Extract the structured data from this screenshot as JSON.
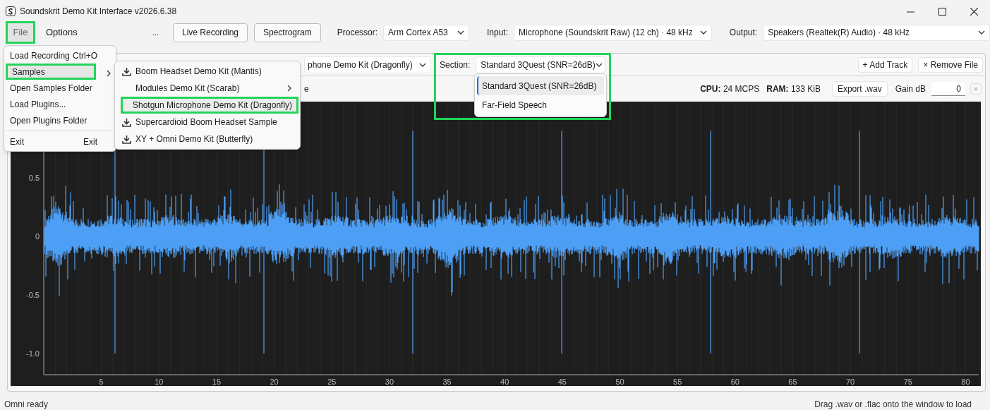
{
  "window": {
    "title": "Soundskrit Demo Kit Interface v2026.6.38"
  },
  "menu_bar": [
    {
      "label": "File",
      "selected": true,
      "highlighted": true
    },
    {
      "label": "Options",
      "selected": false,
      "highlighted": false
    }
  ],
  "toolbar": {
    "overflow": "...",
    "buttons": [
      "Live Recording",
      "Spectrogram"
    ],
    "selectors": [
      {
        "label": "Processor:",
        "value": "Arm Cortex A53"
      },
      {
        "label": "Input:",
        "value": "Microphone (Soundskrit Raw)  (12 ch) · 48 kHz"
      },
      {
        "label": "Output:",
        "value": "Speakers (Realtek(R) Audio) · 48 kHz"
      }
    ]
  },
  "file_row": {
    "file_select": "phone Demo Kit (Dragonfly)",
    "section": {
      "label": "Section:",
      "value": "Standard 3Quest (SNR=26dB)",
      "highlighted": true
    },
    "buttons": [
      "+ Add Track",
      "× Remove File"
    ]
  },
  "info_row": {
    "partial_text": "e",
    "cpu_label": "CPU:",
    "cpu": "24 MCPS",
    "ram_label": "RAM:",
    "ram": "133 KiB",
    "export": "Export .wav",
    "gain_label": "Gain dB",
    "gain": "0",
    "close": "×"
  },
  "waveform": {
    "y_ticks": [
      "0.5",
      "0",
      "-0.5",
      "-1.0"
    ],
    "x_ticks": [
      "5",
      "10",
      "15",
      "20",
      "25",
      "30",
      "35",
      "40",
      "45",
      "50",
      "55",
      "60",
      "65",
      "70",
      "75",
      "80"
    ]
  },
  "file_menu": [
    {
      "label": "Load Recording",
      "shortcut": "Ctrl+O",
      "selected": false,
      "highlighted": false
    },
    {
      "label": "Samples",
      "submenu": true,
      "selected": true,
      "highlighted": true
    },
    {
      "label": "Open Samples Folder",
      "selected": false,
      "highlighted": false
    },
    {
      "label": "Load Plugins...",
      "selected": false,
      "highlighted": false
    },
    {
      "label": "Open Plugins Folder",
      "selected": false,
      "highlighted": false
    },
    {
      "label": "Exit",
      "shortcut": "Exit",
      "separator_before": true,
      "selected": false,
      "highlighted": false
    }
  ],
  "samples_menu": [
    {
      "label": "Boom Headset Demo Kit (Mantis)",
      "kind": "download",
      "highlighted": false
    },
    {
      "label": "Modules Demo Kit (Scarab)",
      "kind": "submenu",
      "highlighted": false
    },
    {
      "label": "Shotgun Microphone Demo Kit (Dragonfly)",
      "kind": "plain",
      "highlighted": true
    },
    {
      "label": "Supercardioid Boom Headset Sample",
      "kind": "download",
      "highlighted": false
    },
    {
      "label": "XY + Omni Demo Kit (Butterfly)",
      "kind": "download",
      "highlighted": false
    }
  ],
  "section_options": [
    {
      "label": "Standard 3Quest (SNR=26dB)",
      "selected": true
    },
    {
      "label": "Far-Field Speech",
      "selected": false
    }
  ],
  "status_bar": {
    "left": "Omni ready",
    "right": "Drag .wav or .flac onto the window to load"
  }
}
